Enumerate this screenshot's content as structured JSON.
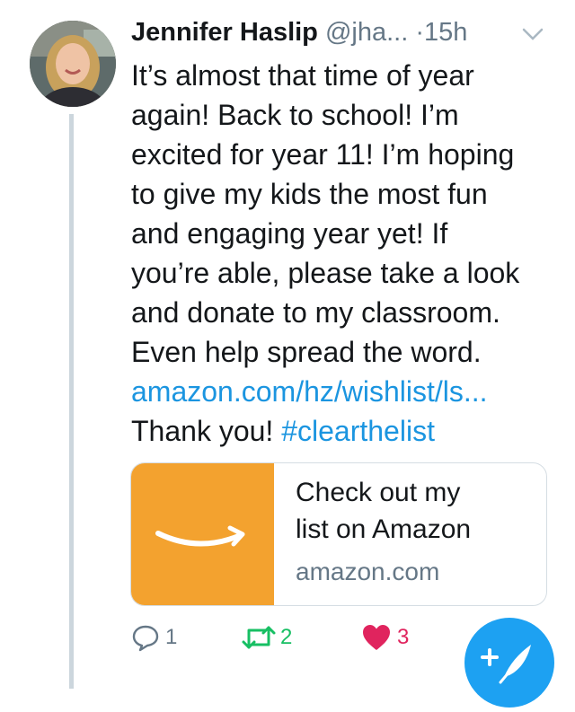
{
  "tweet": {
    "author_name": "Jennifer Haslip",
    "handle": "@jha...",
    "separator": "·",
    "time": "15h",
    "text_lines": [
      "It’s almost that time of year",
      "again! Back to school! I’m",
      "excited for year 11! I’m hoping",
      "to give my kids the most fun",
      "and engaging year yet! If",
      "you’re able, please take a look",
      "and donate to my classroom.",
      "Even help spread the word."
    ],
    "link_text": "amazon.com/hz/wishlist/ls...",
    "closing_text": "Thank you! ",
    "hashtag": "#clearthelist",
    "card": {
      "title_line1": "Check out my",
      "title_line2": "list on Amazon",
      "domain": "amazon.com"
    },
    "actions": {
      "reply_count": "1",
      "retweet_count": "2",
      "like_count": "3"
    }
  },
  "colors": {
    "link_blue": "#1b95e0",
    "retweet_green": "#17bf63",
    "like_red": "#e0245e",
    "fab_blue": "#1da1f2",
    "amazon_orange": "#f3a22f",
    "muted_gray": "#657786"
  },
  "icons": {
    "reply": "reply-icon",
    "retweet": "retweet-icon",
    "like": "heart-icon",
    "compose": "compose-tweet-icon",
    "more": "chevron-down-icon",
    "card_logo": "amazon-smile-logo"
  }
}
